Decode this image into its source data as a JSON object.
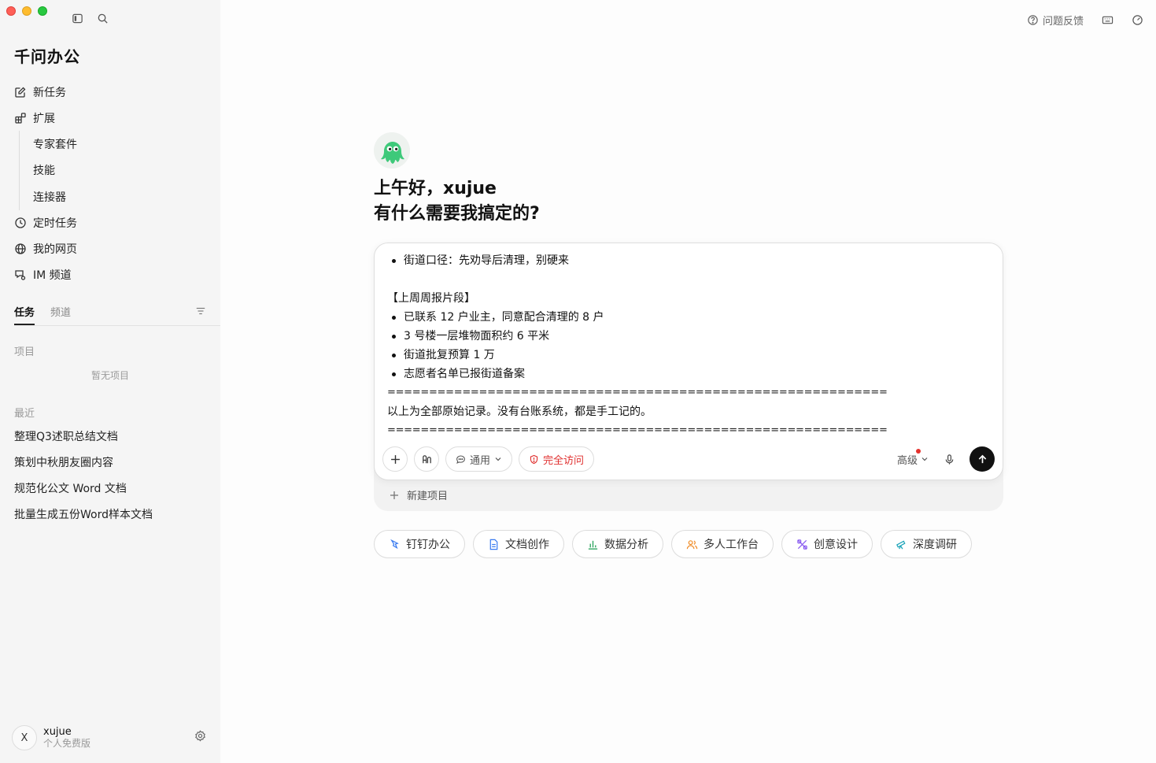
{
  "sidebar": {
    "brand": "千问办公",
    "nav": {
      "new_task": "新任务",
      "extensions": "扩展",
      "sub": [
        "专家套件",
        "技能",
        "连接器"
      ],
      "scheduled": "定时任务",
      "my_pages": "我的网页",
      "im_channel": "IM 频道"
    },
    "tabs": [
      "任务",
      "频道"
    ],
    "projects_label": "项目",
    "projects_empty": "暂无项目",
    "recent_label": "最近",
    "recent": [
      "整理Q3述职总结文档",
      "策划中秋朋友圈内容",
      "规范化公文 Word 文档",
      "批量生成五份Word样本文档"
    ],
    "user": {
      "initial": "X",
      "name": "xujue",
      "plan": "个人免费版"
    }
  },
  "header": {
    "feedback": "问题反馈"
  },
  "hero": {
    "greeting_line1": "上午好，xujue",
    "greeting_line2": "有什么需要我搞定的?"
  },
  "composer": {
    "lines": {
      "l1": "街道口径：先劝导后清理，别硬来",
      "l2": "【上周周报片段】",
      "l3": "已联系 12 户业主，同意配合清理的 8 户",
      "l4": "3 号楼一层堆物面积约 6 平米",
      "l5": "街道批复预算 1 万",
      "l6": "志愿者名单已报街道备案",
      "rule": "============================================================",
      "l7": "以上为全部原始记录。没有台账系统，都是手工记的。"
    },
    "mode": "通用",
    "access": "完全访问",
    "advanced": "高级",
    "new_project": "新建项目"
  },
  "quick_actions": [
    "钉钉办公",
    "文档创作",
    "数据分析",
    "多人工作台",
    "创意设计",
    "深度调研"
  ],
  "colors": {
    "danger": "#e0302f",
    "send": "#111111",
    "mascot": "#3ec97a"
  }
}
